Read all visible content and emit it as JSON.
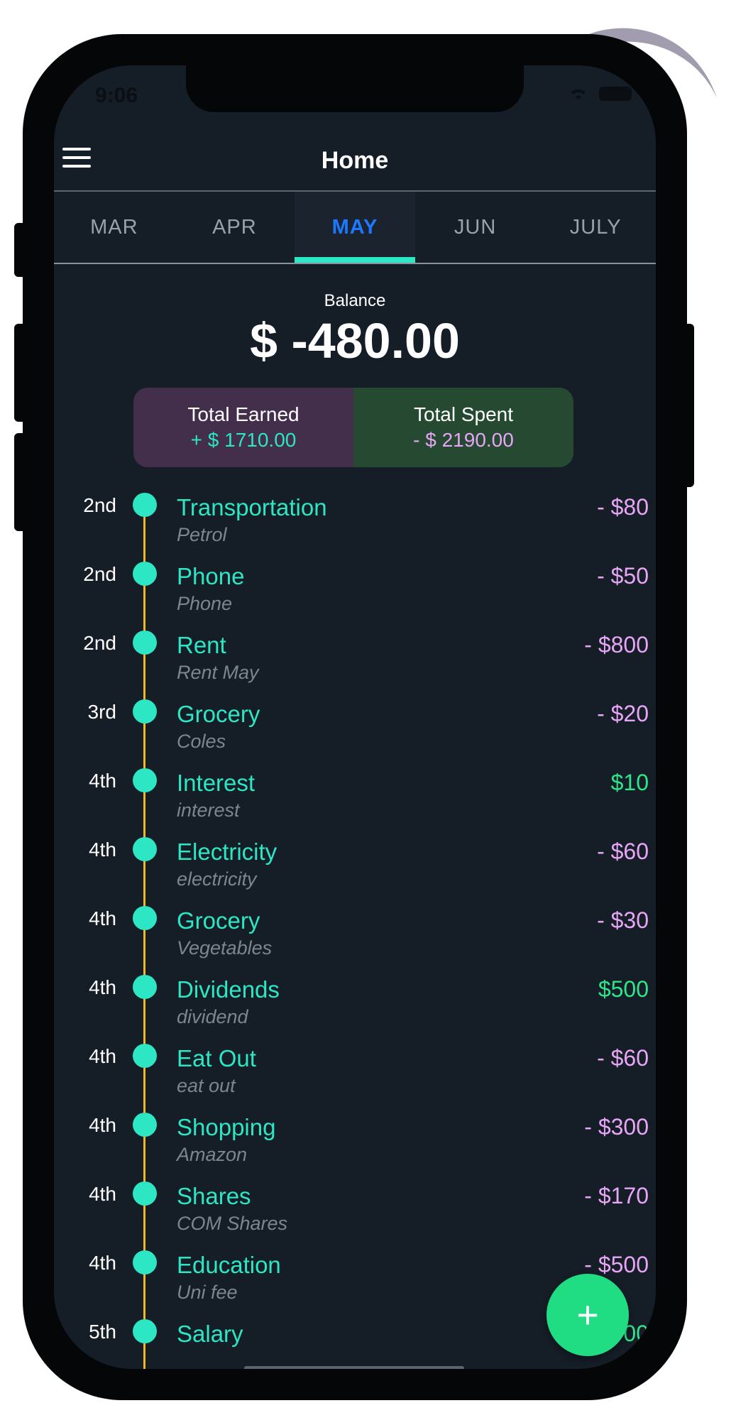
{
  "status_bar": {
    "time": "9:06"
  },
  "header": {
    "title": "Home"
  },
  "tabs": [
    {
      "label": "MAR"
    },
    {
      "label": "APR"
    },
    {
      "label": "MAY",
      "active": true
    },
    {
      "label": "JUN"
    },
    {
      "label": "JULY"
    }
  ],
  "balance": {
    "label": "Balance",
    "value": "$ -480.00",
    "total_earned_label": "Total Earned",
    "total_earned_value": "+ $ 1710.00",
    "total_spent_label": "Total Spent",
    "total_spent_value": "- $ 2190.00"
  },
  "transactions": [
    {
      "day": "2nd",
      "category": "Transportation",
      "note": "Petrol",
      "amount": "- $80",
      "kind": "out"
    },
    {
      "day": "2nd",
      "category": "Phone",
      "note": "Phone",
      "amount": "- $50",
      "kind": "out"
    },
    {
      "day": "2nd",
      "category": "Rent",
      "note": "Rent May",
      "amount": "- $800",
      "kind": "out"
    },
    {
      "day": "3rd",
      "category": "Grocery",
      "note": "Coles",
      "amount": "- $20",
      "kind": "out"
    },
    {
      "day": "4th",
      "category": "Interest",
      "note": "interest",
      "amount": "$10",
      "kind": "in"
    },
    {
      "day": "4th",
      "category": "Electricity",
      "note": "electricity",
      "amount": "- $60",
      "kind": "out"
    },
    {
      "day": "4th",
      "category": "Grocery",
      "note": "Vegetables",
      "amount": "- $30",
      "kind": "out"
    },
    {
      "day": "4th",
      "category": "Dividends",
      "note": "dividend",
      "amount": "$500",
      "kind": "in"
    },
    {
      "day": "4th",
      "category": "Eat Out",
      "note": "eat out",
      "amount": "- $60",
      "kind": "out"
    },
    {
      "day": "4th",
      "category": "Shopping",
      "note": "Amazon",
      "amount": "- $300",
      "kind": "out"
    },
    {
      "day": "4th",
      "category": "Shares",
      "note": "COM Shares",
      "amount": "- $170",
      "kind": "out"
    },
    {
      "day": "4th",
      "category": "Education",
      "note": "Uni fee",
      "amount": "- $500",
      "kind": "out"
    },
    {
      "day": "5th",
      "category": "Salary",
      "note": "",
      "amount": "00",
      "kind": "in"
    }
  ],
  "fab": {
    "icon": "plus-icon",
    "label": "+"
  },
  "colors": {
    "background": "#151d27",
    "accent_teal": "#2ce6c4",
    "active_tab": "#1e78ff",
    "expense": "#e7a6f5",
    "income": "#2ee58a",
    "timeline": "#f2b81e",
    "earned_box": "#432e4b",
    "spent_box": "#264a31"
  }
}
